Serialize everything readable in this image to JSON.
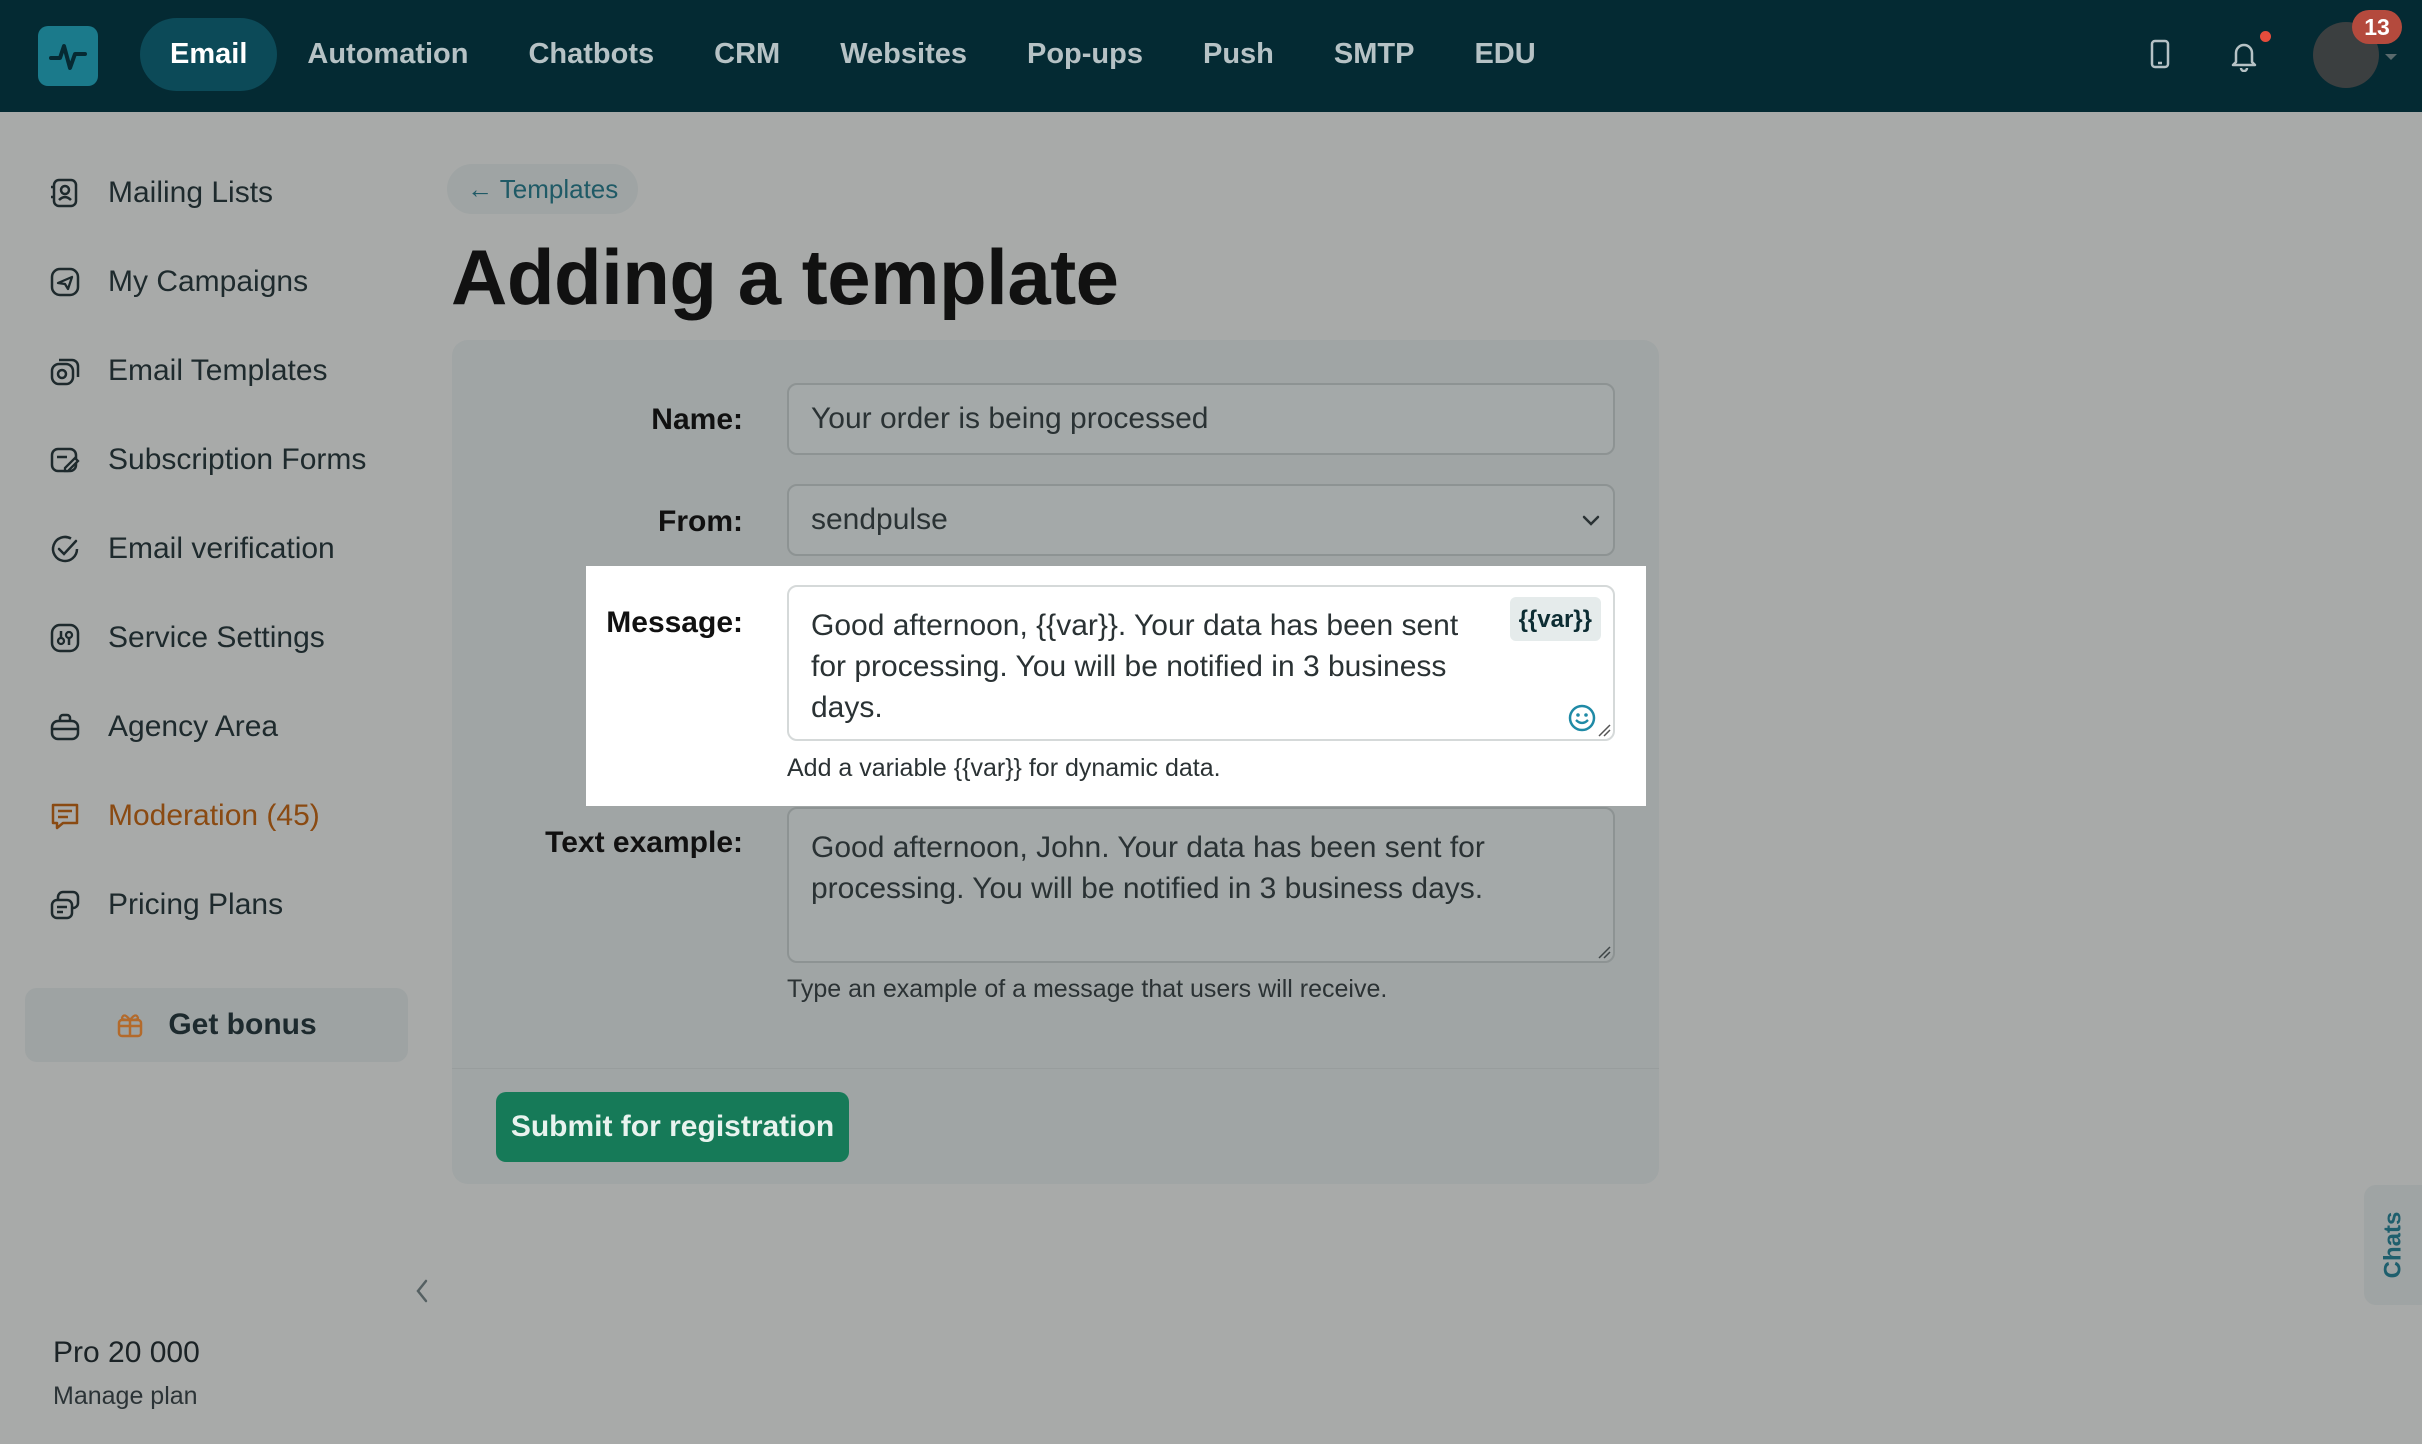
{
  "app": {
    "brand_color": "#1b7a8b",
    "topbar_color": "#042a33",
    "accent_color": "#167a58"
  },
  "nav": {
    "items": [
      {
        "label": "Email",
        "active": true
      },
      {
        "label": "Automation"
      },
      {
        "label": "Chatbots"
      },
      {
        "label": "CRM"
      },
      {
        "label": "Websites"
      },
      {
        "label": "Pop-ups"
      },
      {
        "label": "Push"
      },
      {
        "label": "SMTP"
      },
      {
        "label": "EDU"
      }
    ],
    "icons": [
      "mobile-icon",
      "bell-icon"
    ],
    "avatar_badge": "13"
  },
  "sidebar": {
    "items": [
      {
        "label": "Mailing Lists",
        "icon": "contacts-icon"
      },
      {
        "label": "My Campaigns",
        "icon": "campaign-icon"
      },
      {
        "label": "Email Templates",
        "icon": "template-icon"
      },
      {
        "label": "Subscription Forms",
        "icon": "form-icon"
      },
      {
        "label": "Email verification",
        "icon": "check-circle-icon"
      },
      {
        "label": "Service Settings",
        "icon": "settings-icon"
      },
      {
        "label": "Agency Area",
        "icon": "briefcase-icon"
      },
      {
        "label": "Moderation (45)",
        "icon": "chat-icon"
      },
      {
        "label": "Pricing Plans",
        "icon": "pricing-icon"
      }
    ],
    "bonus_label": "Get bonus",
    "plan_name": "Pro 20 000",
    "plan_manage": "Manage plan"
  },
  "main": {
    "back_label": "← Templates",
    "title": "Adding a template",
    "form": {
      "name_label": "Name:",
      "name_value": "Your order is being processed",
      "from_label": "From:",
      "from_value": "sendpulse",
      "message_label": "Message:",
      "message_value": "Good afternoon, {{var}}. Your data has been sent for processing. You will be notified in 3 business days.",
      "var_chip": "{{var}}",
      "message_helper": "Add a variable {{var}} for dynamic data.",
      "example_label": "Text example:",
      "example_value": "Good afternoon, John. Your data has been sent for processing. You will be notified in 3 business days.",
      "example_helper": "Type an example of a message that users will receive."
    },
    "submit_label": "Submit for registration"
  },
  "chats_tab": "Chats"
}
